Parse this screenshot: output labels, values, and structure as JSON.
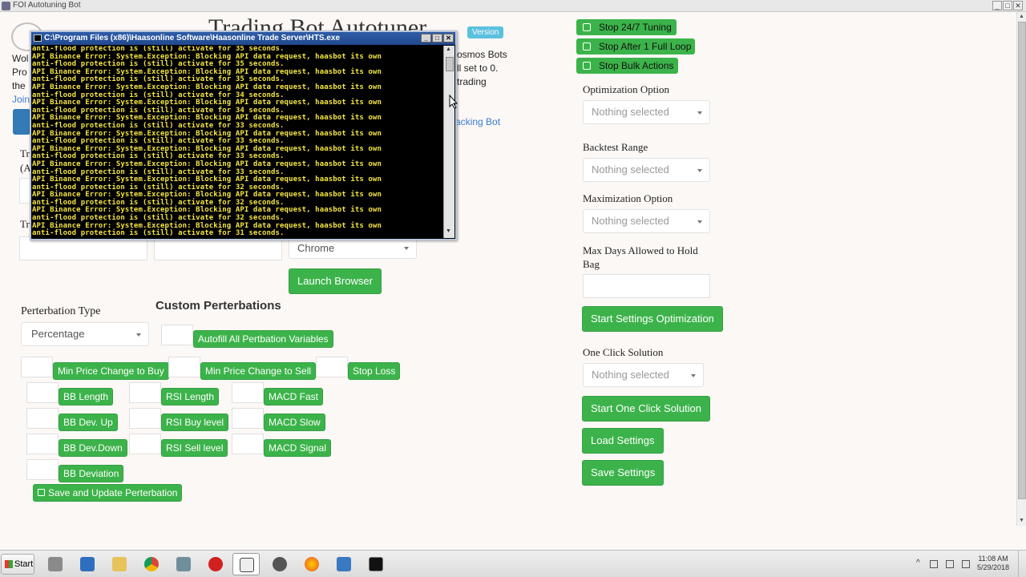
{
  "window": {
    "title": "FOI Autotuning Bot",
    "controls": [
      "_",
      "□",
      "✕"
    ]
  },
  "header": {
    "title_partial": "Trading Bot Autotuner",
    "version_badge": "Version"
  },
  "bg_fragments": {
    "left_lines": [
      "Wol",
      "Pro",
      "the",
      "Join"
    ],
    "mid_lines": [
      "osmos Bots",
      "ll set to 0.",
      "trading"
    ],
    "link_tail": "acking Bot",
    "tr_a": "Tr",
    "tr_b": "(A",
    "tr_c": "Tr"
  },
  "console": {
    "title": "C:\\Program Files (x86)\\Haasonline Software\\Haasonline Trade Server\\HTS.exe",
    "lines": [
      "anti-flood protection is (still) activate for 35 seconds.",
      "API Binance Error: System.Exception: Blocking API data request, haasbot its own",
      "anti-flood protection is (still) activate for 35 seconds.",
      "API Binance Error: System.Exception: Blocking API data request, haasbot its own",
      "anti-flood protection is (still) activate for 35 seconds.",
      "API Binance Error: System.Exception: Blocking API data request, haasbot its own",
      "anti-flood protection is (still) activate for 34 seconds.",
      "API Binance Error: System.Exception: Blocking API data request, haasbot its own",
      "anti-flood protection is (still) activate for 34 seconds.",
      "API Binance Error: System.Exception: Blocking API data request, haasbot its own",
      "anti-flood protection is (still) activate for 33 seconds.",
      "API Binance Error: System.Exception: Blocking API data request, haasbot its own",
      "anti-flood protection is (still) activate for 33 seconds.",
      "API Binance Error: System.Exception: Blocking API data request, haasbot its own",
      "anti-flood protection is (still) activate for 33 seconds.",
      "API Binance Error: System.Exception: Blocking API data request, haasbot its own",
      "anti-flood protection is (still) activate for 33 seconds.",
      "API Binance Error: System.Exception: Blocking API data request, haasbot its own",
      "anti-flood protection is (still) activate for 32 seconds.",
      "API Binance Error: System.Exception: Blocking API data request, haasbot its own",
      "anti-flood protection is (still) activate for 32 seconds.",
      "API Binance Error: System.Exception: Blocking API data request, haasbot its own",
      "anti-flood protection is (still) activate for 32 seconds.",
      "API Binance Error: System.Exception: Blocking API data request, haasbot its own",
      "anti-flood protection is (still) activate for 31 seconds."
    ]
  },
  "left": {
    "browser_select": "Chrome",
    "launch_button": "Launch Browser",
    "perterbation_type_label": "Perterbation Type",
    "perterbation_type_value": "Percentage",
    "custom_perterbations_title": "Custom Perterbations",
    "autofill_button": "Autofill All Pertbation Variables",
    "row1": [
      "Min Price Change to Buy",
      "Min Price Change to Sell",
      "Stop Loss"
    ],
    "bb": [
      "BB Length",
      "BB Dev. Up",
      "BB Dev.Down",
      "BB Deviation"
    ],
    "rsi": [
      "RSI Length",
      "RSI Buy level",
      "RSI Sell level"
    ],
    "macd": [
      "MACD Fast",
      "MACD Slow",
      "MACD Signal"
    ],
    "save_update_button": "Save and Update Perterbation"
  },
  "right": {
    "toggles": [
      "Stop 24/7 Tuning",
      "Stop After 1 Full Loop",
      "Stop Bulk Actions"
    ],
    "optimization_label": "Optimization Option",
    "optimization_value": "Nothing selected",
    "backtest_label": "Backtest Range",
    "backtest_value": "Nothing selected",
    "maximization_label": "Maximization Option",
    "maximization_value": "Nothing selected",
    "max_days_label": "Max Days Allowed to Hold Bag",
    "start_settings_button": "Start Settings Optimization",
    "one_click_label": "One Click Solution",
    "one_click_value": "Nothing selected",
    "start_one_click_button": "Start One Click Solution",
    "load_button": "Load Settings",
    "save_button": "Save Settings"
  },
  "taskbar": {
    "start_label": "Start",
    "clock_time": "11:08 AM",
    "clock_date": "5/29/2018",
    "icons": [
      "server-manager-icon",
      "powershell-icon",
      "file-explorer-icon",
      "chrome-icon",
      "network-icon",
      "bot-app-icon",
      "cursor-tool-icon",
      "gear-app-icon",
      "firefox-icon",
      "remote-desktop-icon",
      "cmd-icon"
    ],
    "colors": {
      "green": "#3cb34a",
      "console_text": "#f4e541",
      "console_title": "#2e5ca8"
    }
  }
}
